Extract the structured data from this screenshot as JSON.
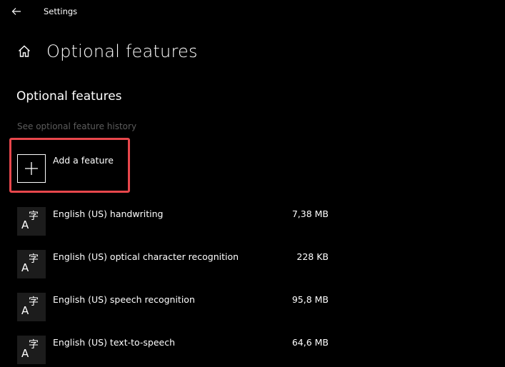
{
  "window": {
    "title": "Settings",
    "back_icon": "back-arrow-icon"
  },
  "header": {
    "home_icon": "home-icon",
    "title": "Optional features"
  },
  "section": {
    "title": "Optional features",
    "history_link": "See optional feature history"
  },
  "add_feature": {
    "label": "Add a feature",
    "icon": "plus-icon",
    "highlight_color": "#e8474c"
  },
  "features": [
    {
      "name": "English (US) handwriting",
      "size": "7,38 MB",
      "icon": "language-icon"
    },
    {
      "name": "English (US) optical character recognition",
      "size": "228 KB",
      "icon": "language-icon"
    },
    {
      "name": "English (US) speech recognition",
      "size": "95,8 MB",
      "icon": "language-icon"
    },
    {
      "name": "English (US) text-to-speech",
      "size": "64,6 MB",
      "icon": "language-icon"
    }
  ],
  "icon_glyphs": {
    "latin": "A",
    "cjk": "字"
  },
  "colors": {
    "background": "#000000",
    "text": "#ffffff",
    "muted_text": "#5c5c5c",
    "icon_tile": "#1c1c1c"
  }
}
